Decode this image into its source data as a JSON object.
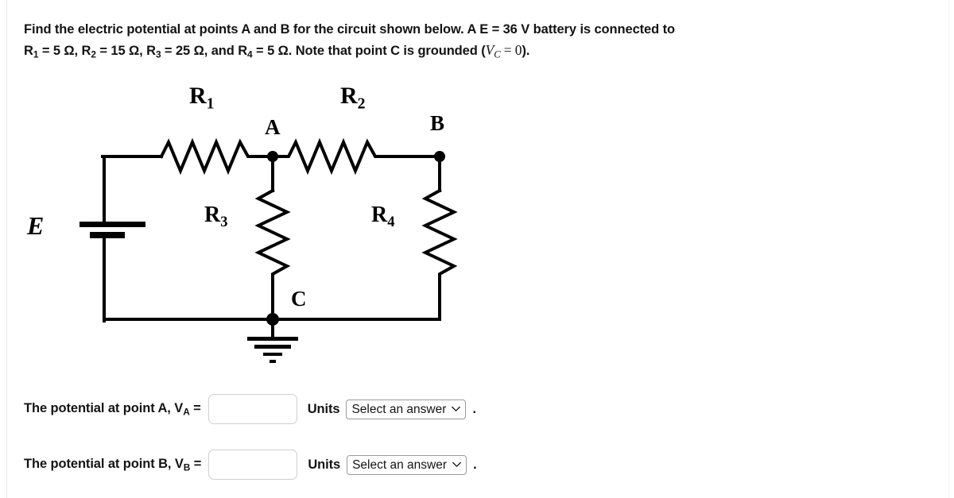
{
  "problem": {
    "line1_part1": "Find the electric potential at points A and B for the circuit shown below. A E = 36 V battery is connected to",
    "line2_prefix": "R",
    "values_text": "R1 = 5 Ω, R2 = 15 Ω, R3 = 25 Ω, and R4 = 5 Ω. Note that point C is grounded (VC = 0).",
    "seg_r1_name": "R",
    "seg_r1_sub": "1",
    "seg_r1_val": " = 5 Ω, ",
    "seg_r2_name": "R",
    "seg_r2_sub": "2",
    "seg_r2_val": " = 15 Ω, ",
    "seg_r3_name": "R",
    "seg_r3_sub": "3",
    "seg_r3_val": " = 25 Ω, and ",
    "seg_r4_name": "R",
    "seg_r4_sub": "4",
    "seg_r4_val": " = 5 Ω. Note that point C is grounded (",
    "seg_vc_name": "V",
    "seg_vc_sub": "C",
    "seg_vc_eq": " = 0",
    "seg_tail": ")."
  },
  "circuit": {
    "battery_label": "E",
    "battery_emf": "36 V",
    "labels": {
      "r1_name": "R",
      "r1_sub": "1",
      "r2_name": "R",
      "r2_sub": "2",
      "r3_name": "R",
      "r3_sub": "3",
      "r4_name": "R",
      "r4_sub": "4",
      "node_a": "A",
      "node_b": "B",
      "node_c": "C"
    },
    "values": {
      "r1": "5 Ω",
      "r2": "15 Ω",
      "r3": "25 Ω",
      "r4": "5 Ω"
    },
    "stroke_color": "#000000"
  },
  "answers": {
    "row_a": {
      "label_text": "The potential at point A, V",
      "label_sub": "A",
      "label_eq": " =",
      "input_value": "",
      "input_placeholder": "",
      "units_label": "Units",
      "select_value": "Select an answer",
      "period": "."
    },
    "row_b": {
      "label_text": "The potential at point B, V",
      "label_sub": "B",
      "label_eq": " =",
      "input_value": "",
      "input_placeholder": "",
      "units_label": "Units",
      "select_value": "Select an answer",
      "period": "."
    }
  }
}
